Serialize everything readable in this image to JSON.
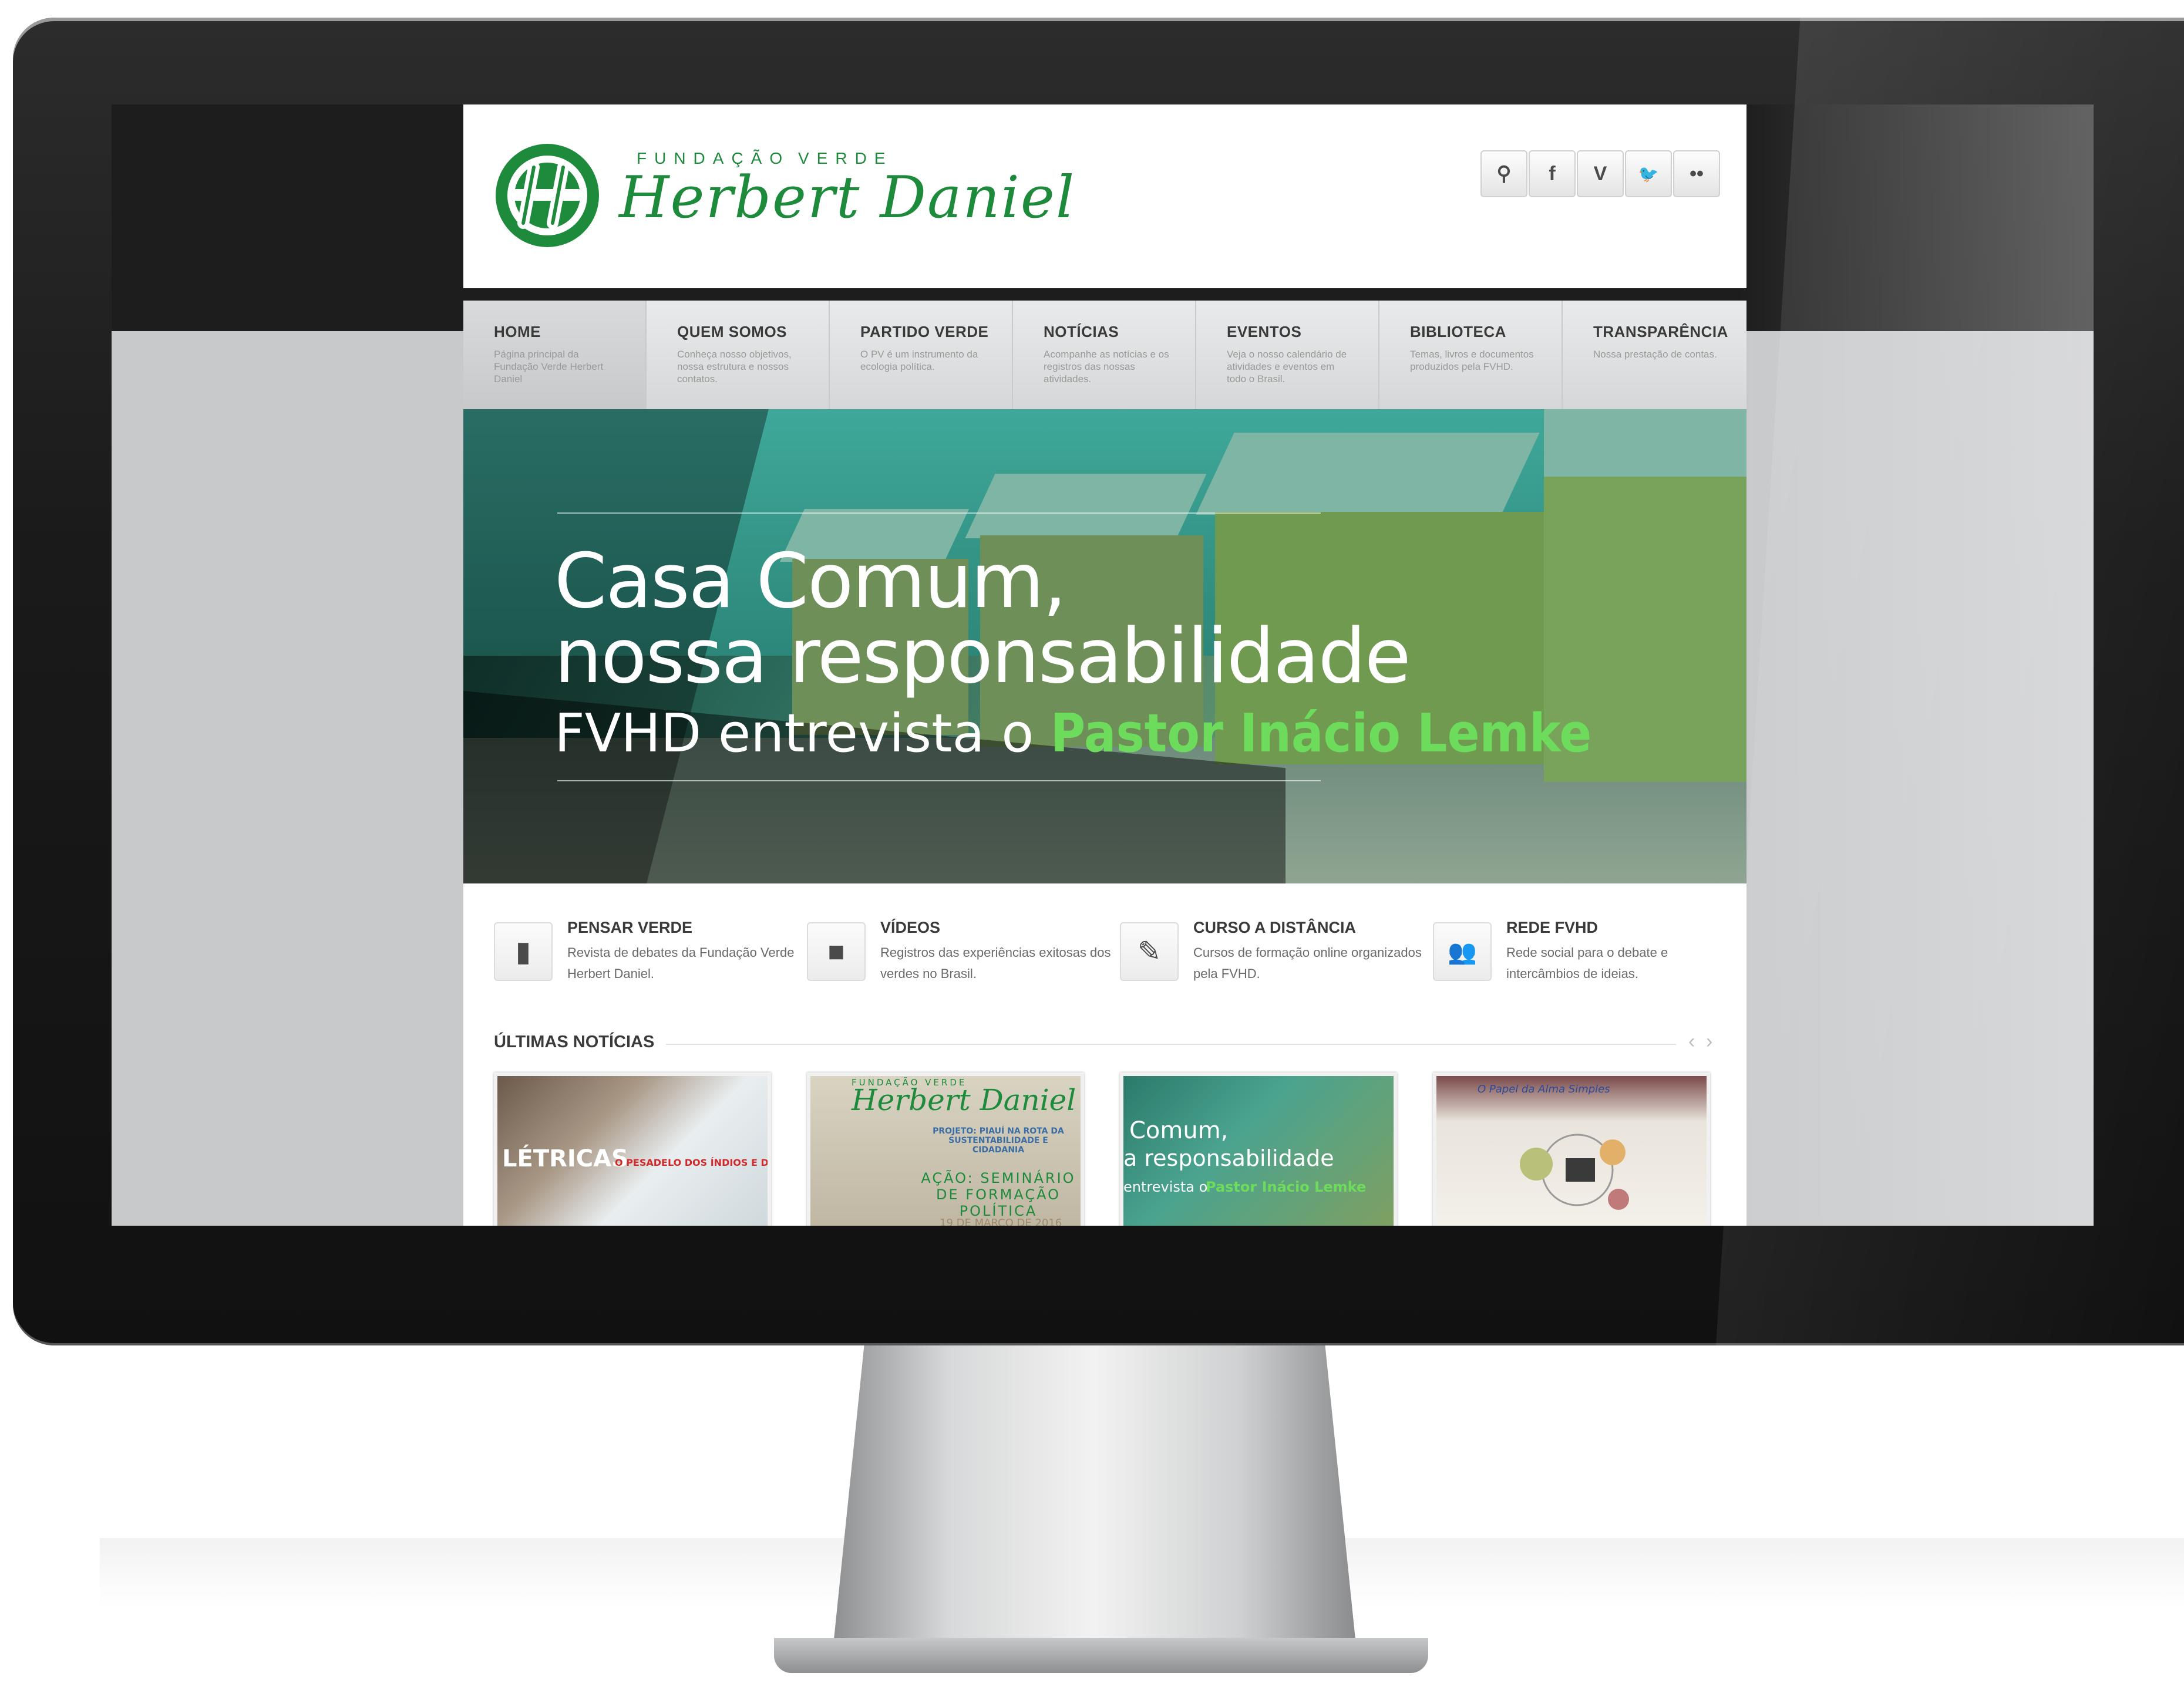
{
  "site": {
    "logo": {
      "top_left": "FUNDAÇÃO",
      "top_right": "VERDE",
      "name": "Herbert Daniel"
    },
    "social": [
      {
        "icon": "search-icon",
        "glyph": "⚲"
      },
      {
        "icon": "facebook-icon",
        "glyph": "f"
      },
      {
        "icon": "vimeo-icon",
        "glyph": "V"
      },
      {
        "icon": "twitter-icon",
        "glyph": "🐦"
      },
      {
        "icon": "flickr-icon",
        "glyph": "••"
      }
    ],
    "nav": [
      {
        "title": "HOME",
        "desc": "Página principal da Fundação Verde Herbert Daniel"
      },
      {
        "title": "QUEM SOMOS",
        "desc": "Conheça nosso objetivos, nossa estrutura e nossos contatos."
      },
      {
        "title": "PARTIDO VERDE",
        "desc": "O PV é um instrumento da ecologia política."
      },
      {
        "title": "NOTÍCIAS",
        "desc": "Acompanhe as notícias e os registros das nossas atividades."
      },
      {
        "title": "EVENTOS",
        "desc": "Veja o nosso calendário de atividades e eventos em todo o Brasil."
      },
      {
        "title": "BIBLIOTECA",
        "desc": "Temas, livros e documentos produzidos pela FVHD."
      },
      {
        "title": "TRANSPARÊNCIA",
        "desc": "Nossa prestação de contas."
      }
    ],
    "hero": {
      "line1": "Casa Comum,",
      "line2": "nossa responsabilidade",
      "line3_prefix": "FVHD entrevista o",
      "line3_highlight": "Pastor Inácio Lemke"
    },
    "features": [
      {
        "icon": "book-icon",
        "glyph": "▮",
        "title": "PENSAR VERDE",
        "desc": "Revista de debates da Fundação Verde Herbert Daniel."
      },
      {
        "icon": "video-camera-icon",
        "glyph": "■",
        "title": "VÍDEOS",
        "desc": "Registros das experiências exitosas dos verdes no Brasil."
      },
      {
        "icon": "pencil-icon",
        "glyph": "✎",
        "title": "CURSO A DISTÂNCIA",
        "desc": "Cursos de formação online organizados pela FVHD."
      },
      {
        "icon": "users-icon",
        "glyph": "👥",
        "title": "REDE FVHD",
        "desc": "Rede social para o debate e intercâmbios de ideias."
      }
    ],
    "news": {
      "title": "ÚLTIMAS NOTÍCIAS",
      "prev": "‹",
      "next": "›",
      "thumbs": [
        {
          "t1": "LÉTRICAS",
          "t2": "O PESADELO DOS ÍNDIOS E DA E"
        },
        {
          "t1": "FUNDAÇÃO VERDE",
          "t2": "Herbert Daniel",
          "t3": "PROJETO: PIAUÍ NA ROTA DA SUSTENTABILIDADE E CIDADANIA",
          "t4": "AÇÃO: SEMINÁRIO DE FORMAÇÃO POLÍTICA",
          "t5": "19 DE MARÇO DE 2016"
        },
        {
          "t1": "Comum,",
          "t2": "a responsabilidade",
          "t3": "entrevista o",
          "t4": "Pastor Inácio Lemke"
        },
        {
          "t1": "O Papel da Alma Simples"
        }
      ]
    }
  },
  "colors": {
    "brand_green": "#1d8a3c",
    "highlight_green": "#6ddb5b"
  }
}
